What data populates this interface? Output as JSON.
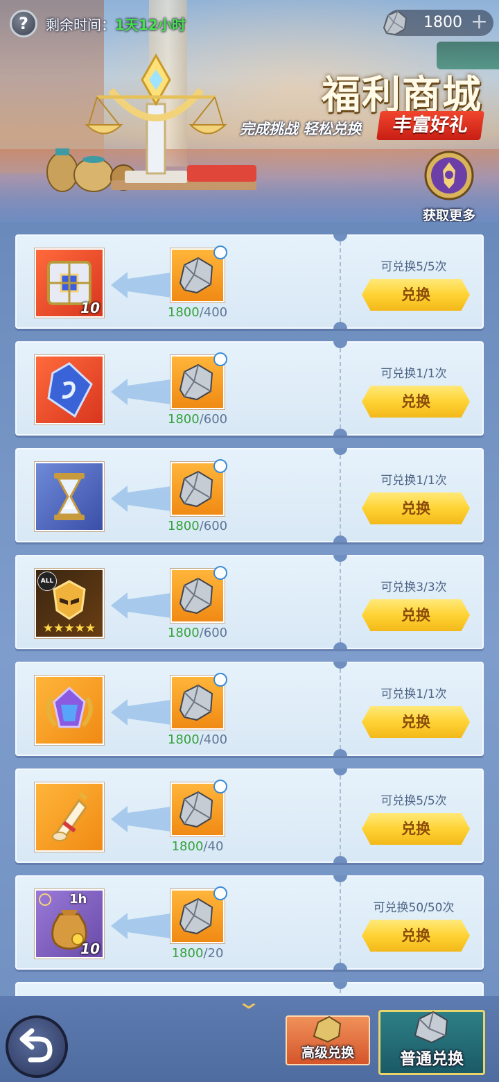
{
  "header": {
    "help_symbol": "?",
    "remaining_label": "剩余时间：",
    "remaining_value": "1天12小时",
    "currency_amount": "1800",
    "currency_plus": "+",
    "currency_icon": "ore-icon"
  },
  "banner": {
    "title": "福利商城",
    "subtitle": "完成挑战 轻松兑换",
    "tag": "丰富好礼",
    "get_more_label": "获取更多"
  },
  "colors": {
    "have_amount": "#34a13a",
    "need_amount": "#5d7596",
    "exchange_button": "#ffd334",
    "timer_value": "#4ade4a"
  },
  "items": [
    {
      "reward_icon": "treasure-chest-icon",
      "reward_count": "10",
      "have": "1800",
      "need": "/400",
      "limit": "可兑换5/5次",
      "button": "兑换"
    },
    {
      "reward_icon": "blue-crystal-icon",
      "reward_count": "",
      "have": "1800",
      "need": "/600",
      "limit": "可兑换1/1次",
      "button": "兑换"
    },
    {
      "reward_icon": "hourglass-icon",
      "reward_count": "",
      "have": "1800",
      "need": "/600",
      "limit": "可兑换1/1次",
      "button": "兑换"
    },
    {
      "reward_icon": "hero-mask-icon",
      "reward_count": "",
      "all_badge": "ALL",
      "stars": "★★★★★",
      "have": "1800",
      "need": "/600",
      "limit": "可兑换3/3次",
      "button": "兑换"
    },
    {
      "reward_icon": "purple-gem-icon",
      "reward_count": "",
      "have": "1800",
      "need": "/400",
      "limit": "可兑换1/1次",
      "button": "兑换"
    },
    {
      "reward_icon": "scroll-icon",
      "reward_count": "",
      "have": "1800",
      "need": "/40",
      "limit": "可兑换5/5次",
      "button": "兑换"
    },
    {
      "reward_icon": "coin-bag-icon",
      "reward_count": "10",
      "time_label": "1h",
      "have": "1800",
      "need": "/20",
      "limit": "可兑换50/50次",
      "button": "兑换"
    }
  ],
  "bottom": {
    "scroll_hint": "⌄",
    "tab_advanced": "高级兑换",
    "tab_normal": "普通兑换"
  }
}
